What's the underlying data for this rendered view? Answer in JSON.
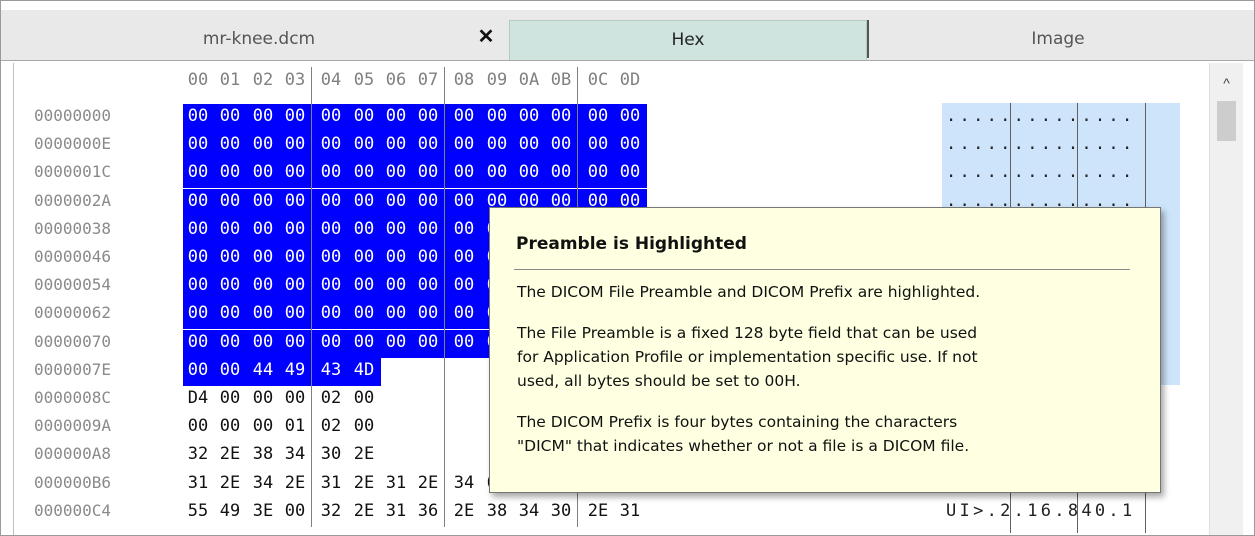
{
  "tabs": {
    "file": "mr-knee.dcm",
    "close": "✕",
    "hex": "Hex",
    "image": "Image"
  },
  "hex_view": {
    "columns": [
      "00",
      "01",
      "02",
      "03",
      "04",
      "05",
      "06",
      "07",
      "08",
      "09",
      "0A",
      "0B",
      "0C",
      "0D"
    ],
    "rows": [
      {
        "offset": "00000000",
        "bytes": [
          "00",
          "00",
          "00",
          "00",
          "00",
          "00",
          "00",
          "00",
          "00",
          "00",
          "00",
          "00",
          "00",
          "00"
        ],
        "ascii": "..............",
        "highlighted": 14
      },
      {
        "offset": "0000000E",
        "bytes": [
          "00",
          "00",
          "00",
          "00",
          "00",
          "00",
          "00",
          "00",
          "00",
          "00",
          "00",
          "00",
          "00",
          "00"
        ],
        "ascii": "..............",
        "highlighted": 14
      },
      {
        "offset": "0000001C",
        "bytes": [
          "00",
          "00",
          "00",
          "00",
          "00",
          "00",
          "00",
          "00",
          "00",
          "00",
          "00",
          "00",
          "00",
          "00"
        ],
        "ascii": "..............",
        "highlighted": 14
      },
      {
        "offset": "0000002A",
        "bytes": [
          "00",
          "00",
          "00",
          "00",
          "00",
          "00",
          "00",
          "00",
          "00",
          "00",
          "00",
          "00",
          "00",
          "00"
        ],
        "ascii": "..............",
        "highlighted": 14
      },
      {
        "offset": "00000038",
        "bytes": [
          "00",
          "00",
          "00",
          "00",
          "00",
          "00",
          "00",
          "00",
          "00",
          "00",
          "00",
          "00",
          "00",
          "00"
        ],
        "ascii": "..............",
        "highlighted": 14
      },
      {
        "offset": "00000046",
        "bytes": [
          "00",
          "00",
          "00",
          "00",
          "00",
          "00",
          "00",
          "00",
          "00",
          "00",
          "00",
          "00",
          "00",
          "00"
        ],
        "ascii": "..............",
        "highlighted": 14
      },
      {
        "offset": "00000054",
        "bytes": [
          "00",
          "00",
          "00",
          "00",
          "00",
          "00",
          "00",
          "00",
          "00",
          "00",
          "00",
          "00",
          "00",
          "00"
        ],
        "ascii": "..............",
        "highlighted": 14
      },
      {
        "offset": "00000062",
        "bytes": [
          "00",
          "00",
          "00",
          "00",
          "00",
          "00",
          "00",
          "00",
          "00",
          "00",
          "00",
          "00",
          "00",
          "00"
        ],
        "ascii": "..............",
        "highlighted": 14
      },
      {
        "offset": "00000070",
        "bytes": [
          "00",
          "00",
          "00",
          "00",
          "00",
          "00",
          "00",
          "00",
          "00",
          "00",
          "00",
          "00",
          "00",
          "00"
        ],
        "ascii": "..............",
        "highlighted": 14
      },
      {
        "offset": "0000007E",
        "bytes": [
          "00",
          "00",
          "44",
          "49",
          "43",
          "4D",
          "",
          "",
          "",
          "",
          "",
          "",
          "",
          ""
        ],
        "ascii": "",
        "highlighted": 6
      },
      {
        "offset": "0000008C",
        "bytes": [
          "D4",
          "00",
          "00",
          "00",
          "02",
          "00",
          "",
          "",
          "",
          "",
          "",
          "",
          "",
          ""
        ],
        "ascii": "",
        "highlighted": 0
      },
      {
        "offset": "0000009A",
        "bytes": [
          "00",
          "00",
          "00",
          "01",
          "02",
          "00",
          "",
          "",
          "",
          "",
          "",
          "",
          "",
          ""
        ],
        "ascii": "",
        "highlighted": 0
      },
      {
        "offset": "000000A8",
        "bytes": [
          "32",
          "2E",
          "38",
          "34",
          "30",
          "2E",
          "",
          "",
          "",
          "",
          "",
          "",
          "",
          ""
        ],
        "ascii": "",
        "highlighted": 0
      },
      {
        "offset": "000000B6",
        "bytes": [
          "31",
          "2E",
          "34",
          "2E",
          "31",
          "2E",
          "31",
          "2E",
          "34",
          "00",
          "02",
          "00",
          "03",
          "00"
        ],
        "ascii": "1.4.1.1.4.....",
        "highlighted": 0
      },
      {
        "offset": "000000C4",
        "bytes": [
          "55",
          "49",
          "3E",
          "00",
          "32",
          "2E",
          "31",
          "36",
          "2E",
          "38",
          "34",
          "30",
          "2E",
          "31"
        ],
        "ascii": "UI>.2.16.840.1",
        "highlighted": 0
      }
    ]
  },
  "tooltip": {
    "title": "Preamble is Highlighted",
    "p1": "The DICOM File Preamble and DICOM Prefix are highlighted.",
    "p2a": "The File Preamble is a fixed 128 byte field that can be used",
    "p2b": "for Application Profile or implementation specific use. If not",
    "p2c": "used, all bytes should be set to 00H.",
    "p3a": "The DICOM Prefix is four bytes containing the characters",
    "p3b": "\"DICM\" that indicates whether or not a file is a DICOM file."
  },
  "scrollbar": {
    "up_arrow": "^"
  },
  "colors": {
    "highlight": "#0000ff",
    "ascii_highlight": "#cde4fa",
    "active_tab": "#cfe3df",
    "tooltip_bg": "#ffffe1"
  }
}
